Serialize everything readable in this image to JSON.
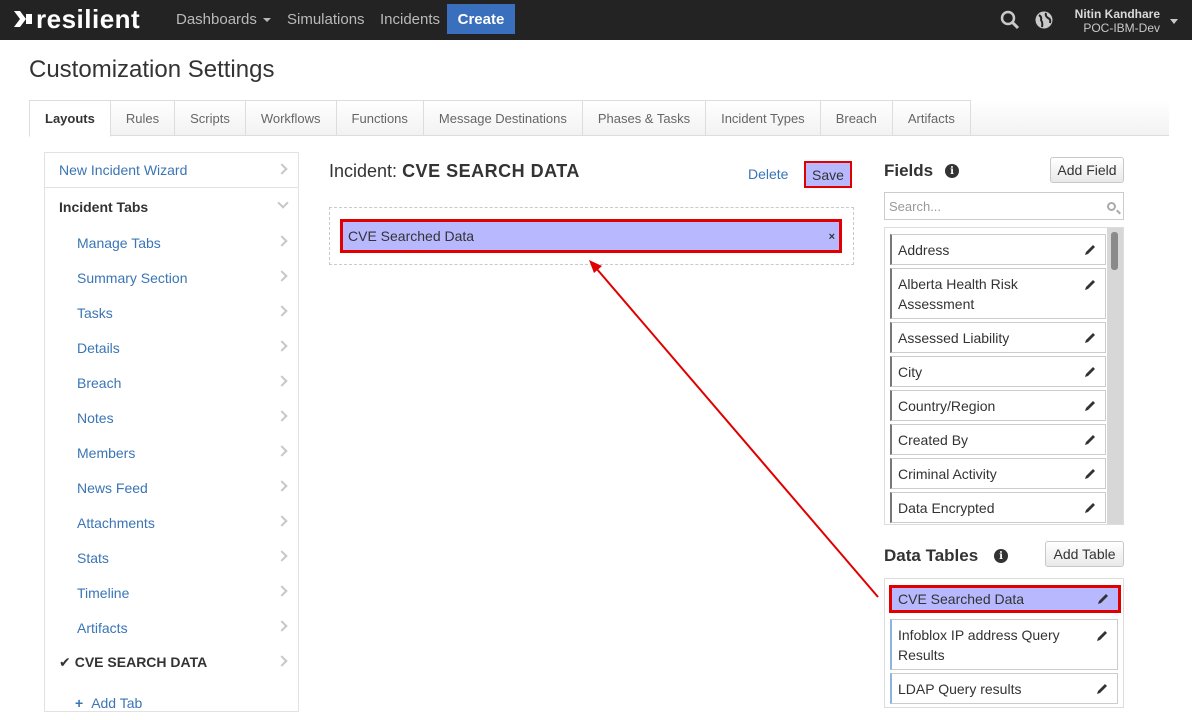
{
  "header": {
    "brand": "resilient",
    "nav": {
      "dashboards": "Dashboards",
      "simulations": "Simulations",
      "incidents": "Incidents"
    },
    "create_label": "Create",
    "user_name": "Nitin Kandhare",
    "user_org": "POC-IBM-Dev"
  },
  "page_title": "Customization Settings",
  "tabs": [
    "Layouts",
    "Rules",
    "Scripts",
    "Workflows",
    "Functions",
    "Message Destinations",
    "Phases & Tasks",
    "Incident Types",
    "Breach",
    "Artifacts"
  ],
  "sidebar": {
    "new_incident_wizard": "New Incident Wizard",
    "incident_tabs": "Incident Tabs",
    "items": [
      "Manage Tabs",
      "Summary Section",
      "Tasks",
      "Details",
      "Breach",
      "Notes",
      "Members",
      "News Feed",
      "Attachments",
      "Stats",
      "Timeline",
      "Artifacts"
    ],
    "current": "CVE SEARCH DATA",
    "add_tab": "Add Tab"
  },
  "editor": {
    "title_prefix": "Incident:",
    "title_name": "CVE SEARCH DATA",
    "delete_label": "Delete",
    "save_label": "Save",
    "dropped_item": "CVE Searched Data",
    "remove_glyph": "×"
  },
  "fields": {
    "title": "Fields",
    "add_label": "Add Field",
    "search_placeholder": "Search...",
    "items": [
      "Address",
      "Alberta Health Risk Assessment",
      "Assessed Liability",
      "City",
      "Country/Region",
      "Created By",
      "Criminal Activity",
      "Data Encrypted"
    ]
  },
  "data_tables": {
    "title": "Data Tables",
    "add_label": "Add Table",
    "items": [
      "CVE Searched Data",
      "Infoblox IP address Query Results",
      "LDAP Query results"
    ]
  },
  "colors": {
    "topbar": "#232323",
    "accent": "#3a6fbe",
    "highlight_fill": "#b8b8ff",
    "annotation_red": "#e00000",
    "link": "#3a75b5"
  }
}
